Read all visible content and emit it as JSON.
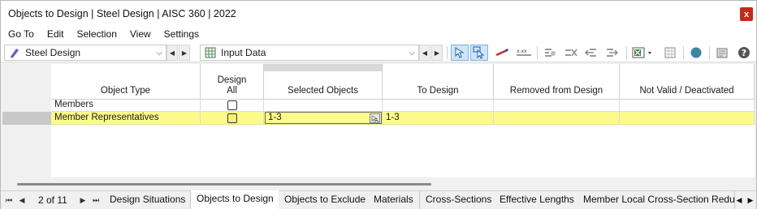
{
  "window": {
    "title": "Objects to Design | Steel Design | AISC 360 | 2022",
    "close_glyph": "x"
  },
  "menu": [
    "Go To",
    "Edit",
    "Selection",
    "View",
    "Settings"
  ],
  "toolbar": {
    "module_combo": {
      "label": "Steel Design",
      "icon": "steel-design-icon"
    },
    "table_combo": {
      "label": "Input Data",
      "icon": "table-grid-icon"
    }
  },
  "table": {
    "columns": [
      "Object Type",
      "Design\nAll",
      "Selected Objects",
      "To Design",
      "Removed from Design",
      "Not Valid / Deactivated"
    ],
    "rows": [
      {
        "object_type": "Members",
        "design_all": false,
        "selected": "",
        "to_design": "",
        "removed": "",
        "not_valid": ""
      },
      {
        "object_type": "Member Representatives",
        "design_all": false,
        "selected": "1-3",
        "to_design": "1-3",
        "removed": "",
        "not_valid": ""
      }
    ],
    "selected_row_color": "#fbfb8c"
  },
  "pager": {
    "text": "2 of 11"
  },
  "tabs": [
    "Design Situations",
    "Objects to Design",
    "Objects to Exclude",
    "Materials",
    "Cross-Sections",
    "Effective Lengths",
    "Member Local Cross-Section Reduct"
  ],
  "active_tab": "Objects to Design"
}
